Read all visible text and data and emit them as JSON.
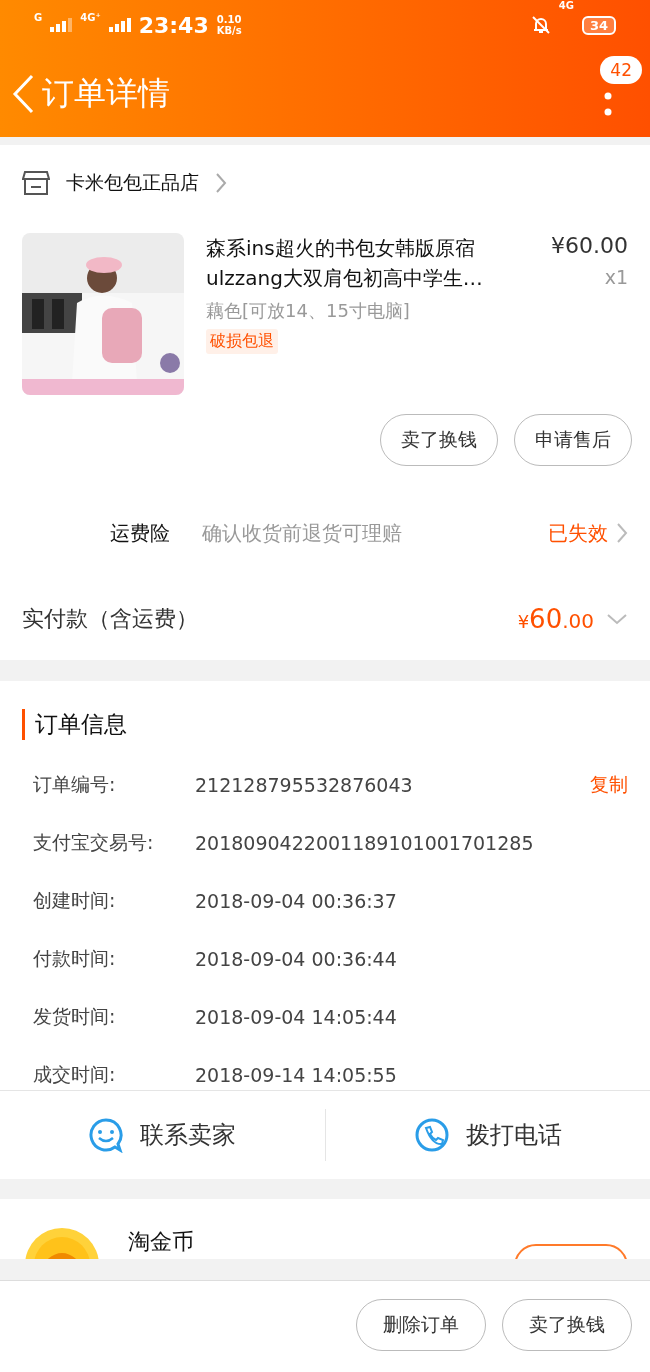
{
  "status_bar": {
    "carrier_1": "G",
    "carrier_2": "4G⁺",
    "time": "23:43",
    "speed": "0.10",
    "speed_unit": "KB/s",
    "network": "4G",
    "battery": "34"
  },
  "nav": {
    "title": "订单详情",
    "badge": "42"
  },
  "shop": {
    "name": "卡米包包正品店"
  },
  "product": {
    "kind": "picture",
    "title": "森系ins超火的书包女韩版原宿ulzzang大双肩包初高中学生…",
    "price": "¥60.00",
    "quantity": "x1",
    "sku": "藕色[可放14、15寸电脑]",
    "tag": "破损包退"
  },
  "item_buttons": [
    "卖了换钱",
    "申请售后"
  ],
  "insurance": {
    "label": "运费险",
    "description": "确认收货前退货可理赔",
    "status": "已失效"
  },
  "payment": {
    "label": "实付款（含运费）",
    "currency": "¥",
    "amount_major": "60",
    "amount_minor": ".00"
  },
  "order_info": {
    "title": "订单信息",
    "copy": "复制",
    "rows": [
      {
        "label": "订单编号:",
        "value": "212128795532876043"
      },
      {
        "label": "支付宝交易号:",
        "value": "2018090422001189101001701285"
      },
      {
        "label": "创建时间:",
        "value": "2018-09-04 00:36:37"
      },
      {
        "label": "付款时间:",
        "value": "2018-09-04 00:36:44"
      },
      {
        "label": "发货时间:",
        "value": "2018-09-04 14:05:44"
      },
      {
        "label": "成交时间:",
        "value": "2018-09-14 14:05:55"
      }
    ]
  },
  "contact": [
    {
      "kind": "chat",
      "label": "联系卖家"
    },
    {
      "kind": "phone",
      "label": "拨打电话"
    }
  ],
  "coins": {
    "title": "淘金币"
  },
  "bottom_buttons": [
    "删除订单",
    "卖了换钱"
  ]
}
